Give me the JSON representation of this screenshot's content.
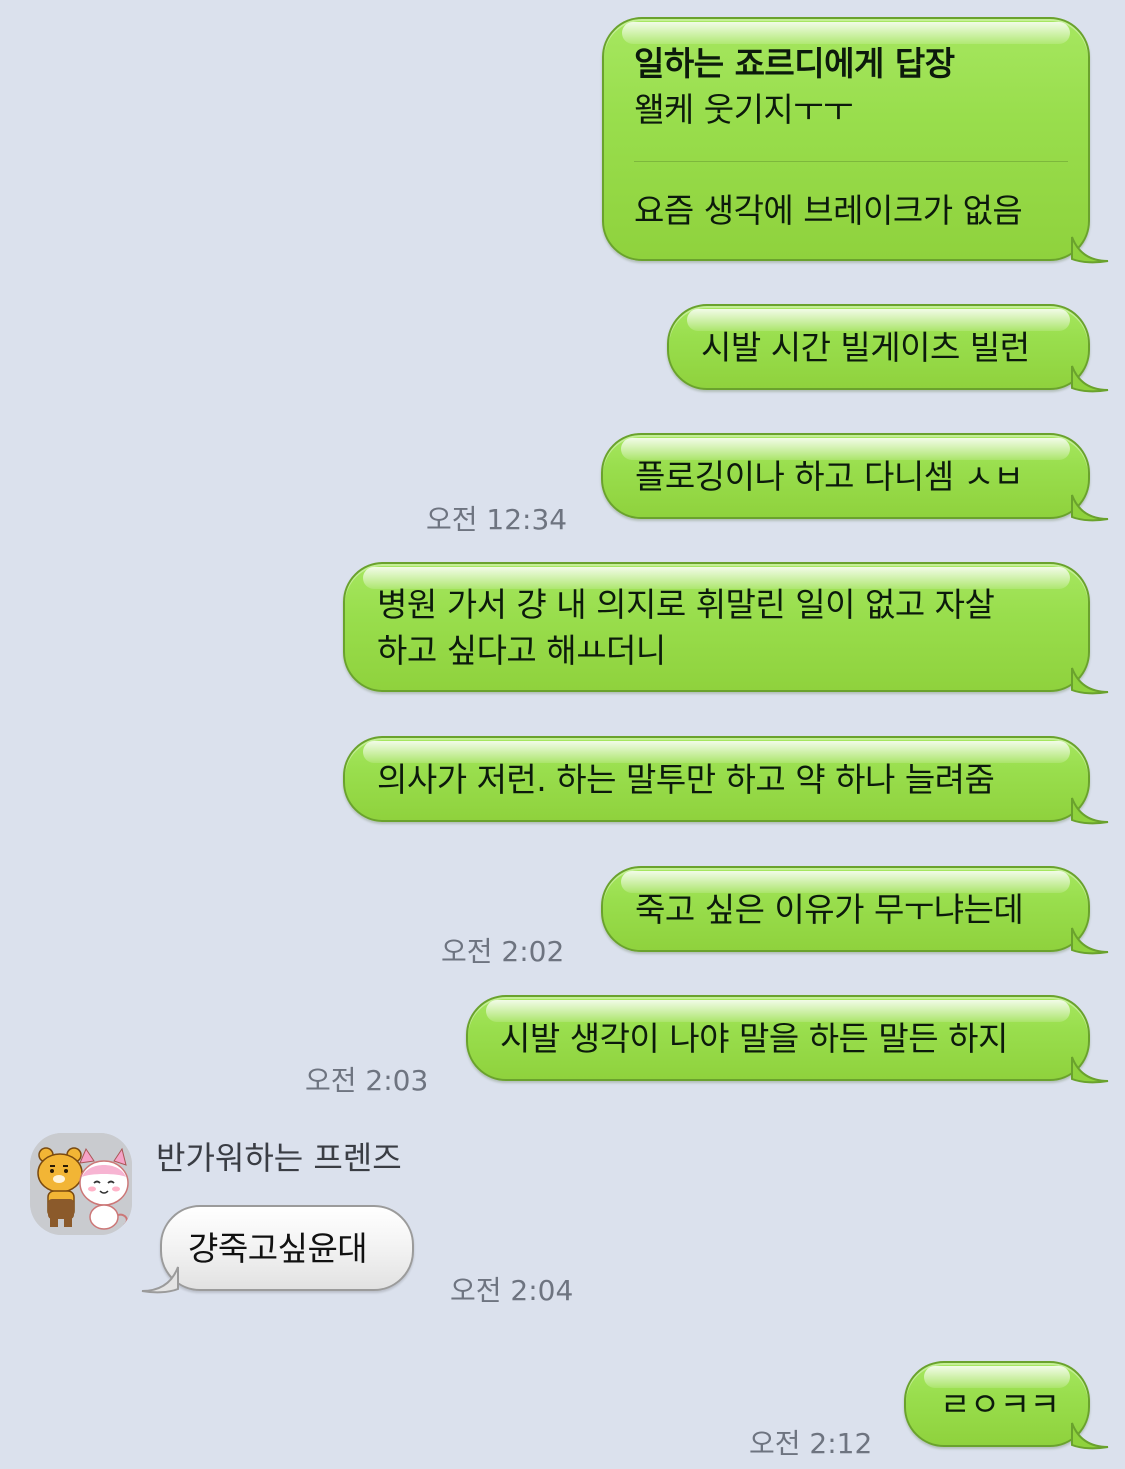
{
  "colors": {
    "background": "#dbe1ed",
    "my_bubble": "#99de4d",
    "their_bubble": "#f4f4f4",
    "timestamp": "#6e7480"
  },
  "messages": [
    {
      "sender": "me",
      "reply_header": "일하는 죠르디에게 답장",
      "reply_quote": "왤케 웃기지ㅜㅜ",
      "text": "요즘 생각에 브레이크가 없음"
    },
    {
      "sender": "me",
      "text": "시발 시간 빌게이츠 빌런"
    },
    {
      "sender": "me",
      "text": "플로깅이나 하고 다니셈 ㅅㅂ",
      "time": "오전 12:34"
    },
    {
      "sender": "me",
      "lines": [
        "병원 가서 걍 내 의지로 휘말린 일이 없고 자살",
        "하고 싶다고 해ㅛ더니"
      ]
    },
    {
      "sender": "me",
      "text": "의사가 저런. 하는 말투만 하고 약 하나 늘려줌"
    },
    {
      "sender": "me",
      "text": "죽고 싶은 이유가 무ㅜ냐는데",
      "time": "오전 2:02"
    },
    {
      "sender": "me",
      "text": "시발 생각이 나야 말을 하든 말든 하지",
      "time": "오전 2:03"
    },
    {
      "sender": "friend",
      "name": "반가워하는 프렌즈",
      "avatar": "ryan-and-apeach-avatar",
      "text": "걍죽고싶윤대",
      "time": "오전 2:04"
    },
    {
      "sender": "me",
      "text": "ㄹㅇㅋㅋ",
      "time": "오전 2:12"
    }
  ]
}
